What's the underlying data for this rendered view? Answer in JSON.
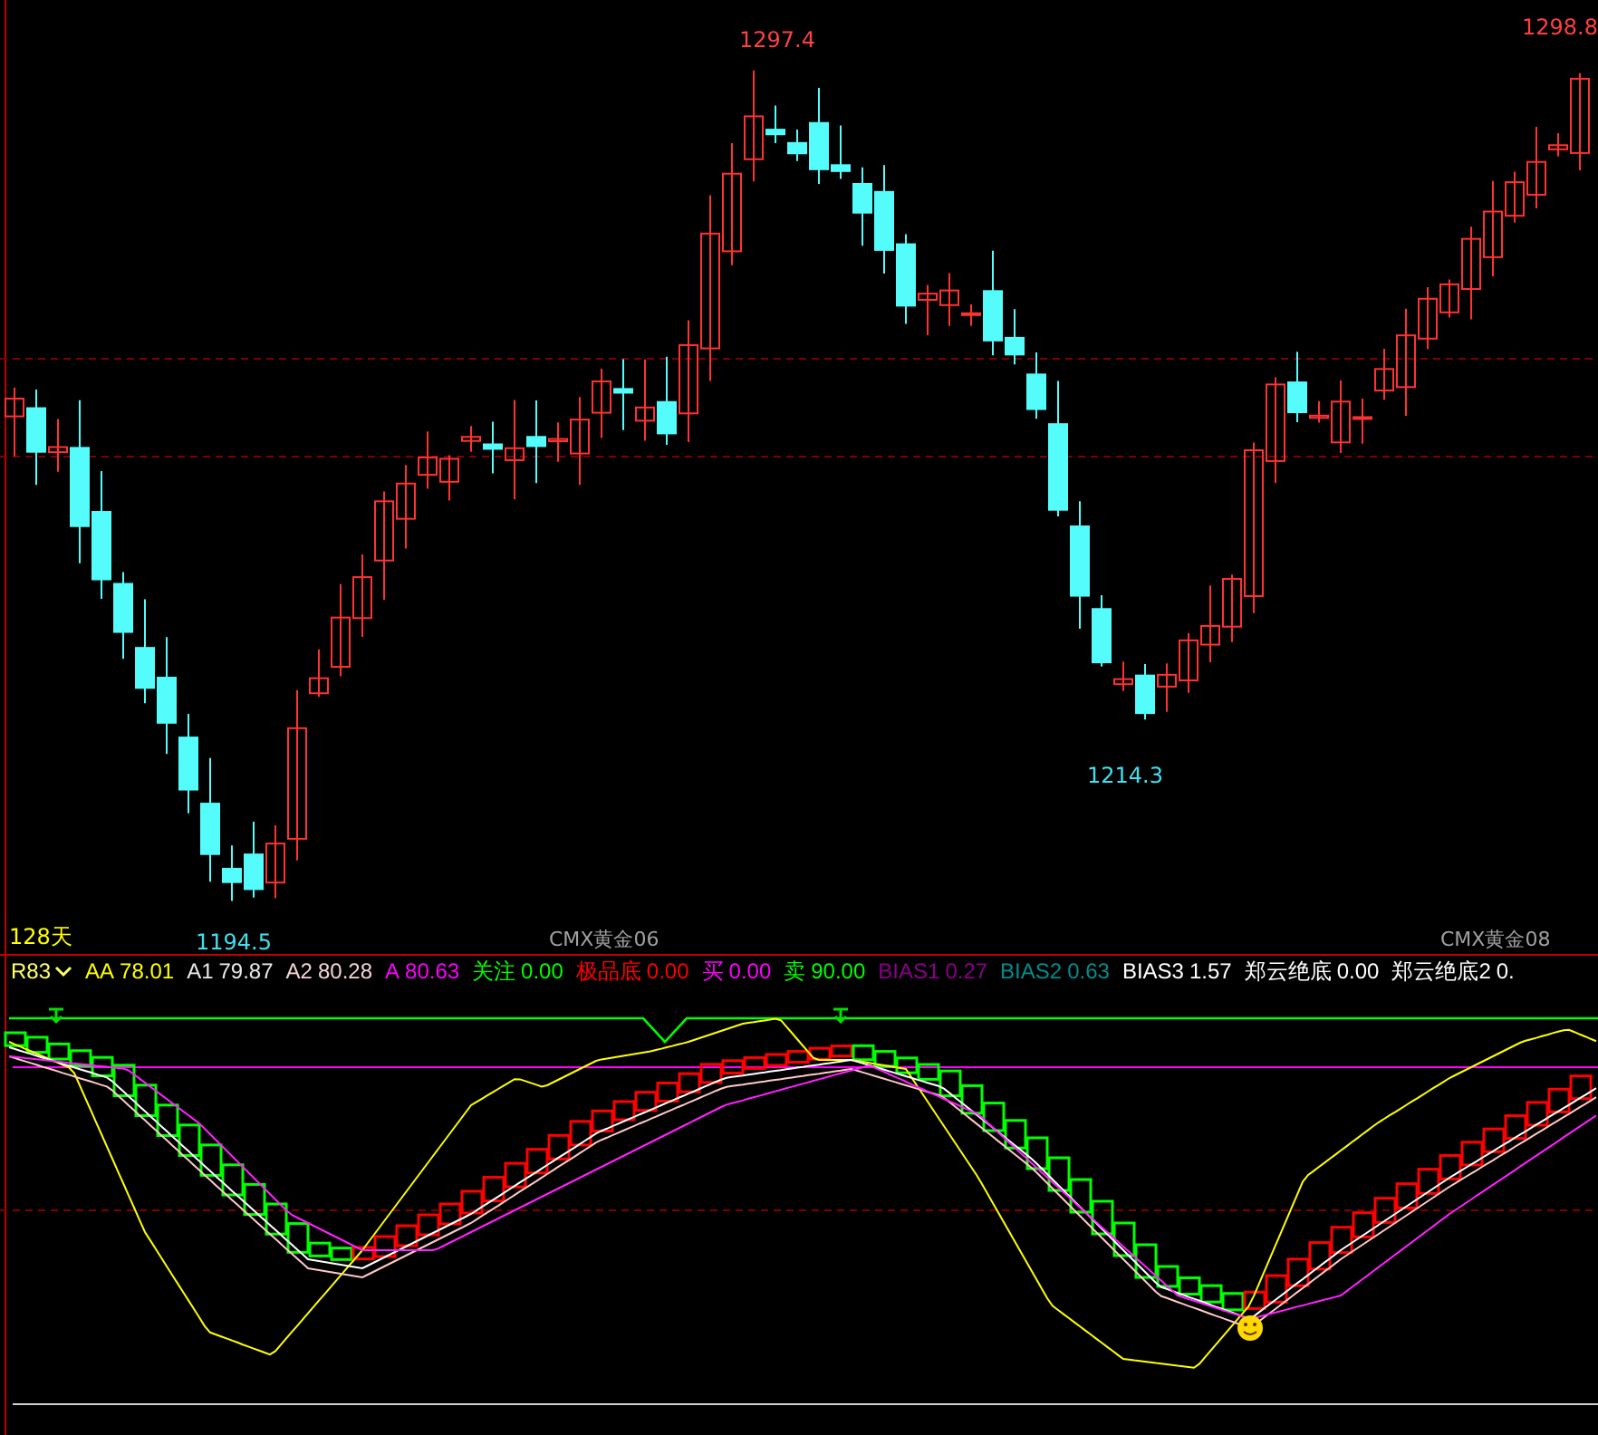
{
  "price_panel": {
    "labels": [
      {
        "kind": "high",
        "text": "1297.4"
      },
      {
        "kind": "high",
        "text": "1298.8"
      },
      {
        "kind": "low",
        "text": "1214.3"
      },
      {
        "kind": "low",
        "text": "1194.5"
      }
    ],
    "period": "128天",
    "contracts": [
      "CMX黄金06",
      "CMX黄金08"
    ]
  },
  "indicator": {
    "name": "R83",
    "values": [
      {
        "label": "AA",
        "value": "78.01",
        "color": "#ffff00"
      },
      {
        "label": "A1",
        "value": "79.87",
        "color": "#e8e8e8"
      },
      {
        "label": "A2",
        "value": "80.28",
        "color": "#f4d4d4"
      },
      {
        "label": "A",
        "value": "80.63",
        "color": "#ff00ff"
      },
      {
        "label": "关注",
        "value": "0.00",
        "color": "#00ff00"
      },
      {
        "label": "极品底",
        "value": "0.00",
        "color": "#ff0000"
      },
      {
        "label": "买",
        "value": "0.00",
        "color": "#ff00ff"
      },
      {
        "label": "卖",
        "value": "90.00",
        "color": "#00ff00"
      },
      {
        "label": "BIAS1",
        "value": "0.27",
        "color": "#8a008a"
      },
      {
        "label": "BIAS2",
        "value": "0.63",
        "color": "#008c8c"
      },
      {
        "label": "BIAS3",
        "value": "1.57",
        "color": "#ffffff"
      },
      {
        "label": "郑云绝底",
        "value": "0.00",
        "color": "#ffffff"
      },
      {
        "label": "郑云绝底2",
        "value": "0.",
        "color": "#ffffff"
      }
    ]
  }
}
